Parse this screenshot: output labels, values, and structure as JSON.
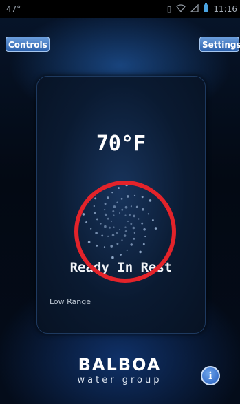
{
  "status_bar": {
    "left_text": "47°",
    "time": "11:16",
    "icons": [
      "vibrate-icon",
      "wifi-icon",
      "signal-icon",
      "battery-icon"
    ]
  },
  "header": {
    "controls_label": "Controls",
    "settings_label": "Settings"
  },
  "main": {
    "temperature": "70°F",
    "status": "Ready In Rest",
    "range": "Low Range",
    "center_icon": "spa-jets-icon"
  },
  "footer": {
    "brand_name": "BALBOA",
    "brand_tagline": "water group",
    "info_label": "i"
  },
  "colors": {
    "button_blue": "#2d62ad",
    "highlight_red": "#e3232a",
    "background": "#03070f"
  }
}
